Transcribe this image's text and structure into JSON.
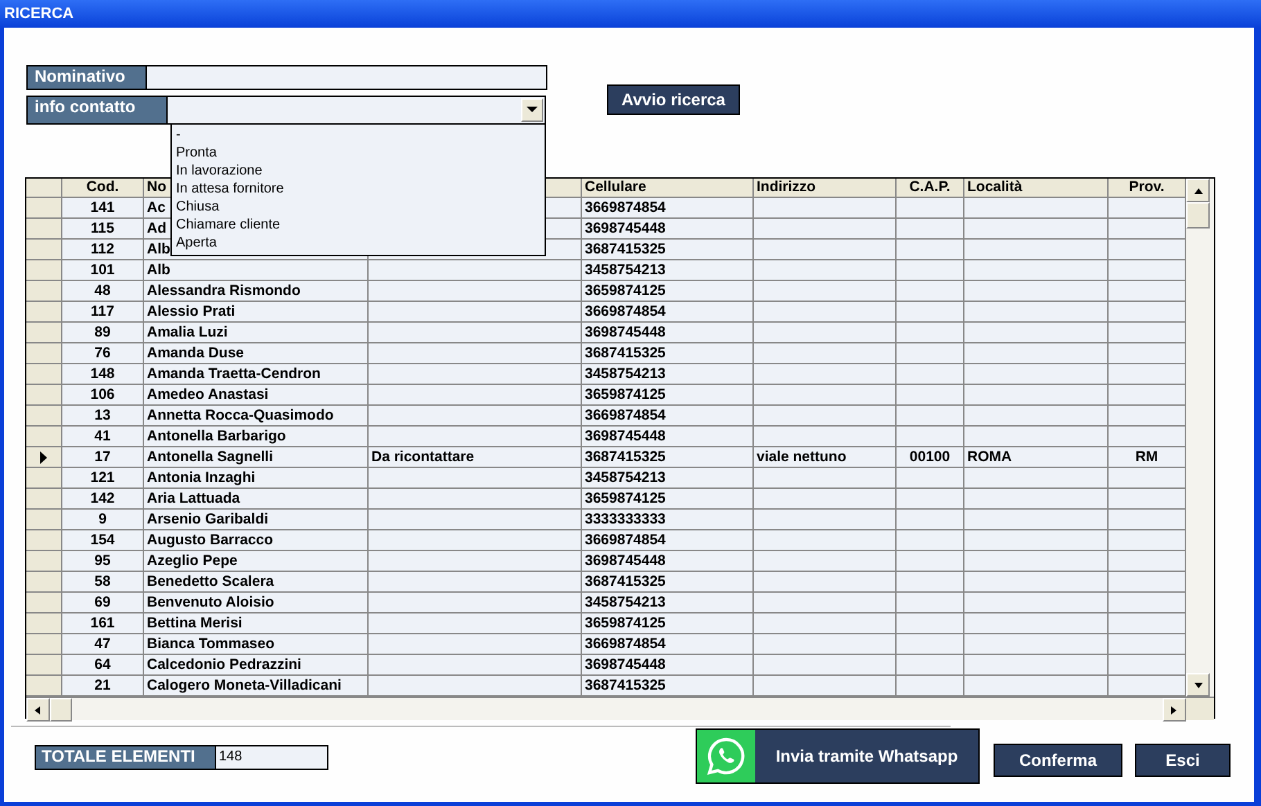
{
  "window": {
    "title": "RICERCA"
  },
  "search": {
    "nominativo": {
      "label": "Nominativo"
    },
    "info_contatto": {
      "label": "info contatto",
      "options": [
        {
          "label": "-"
        },
        {
          "label": "Pronta"
        },
        {
          "label": "In lavorazione"
        },
        {
          "label": "In attesa fornitore"
        },
        {
          "label": "Chiusa"
        },
        {
          "label": "Chiamare cliente"
        },
        {
          "label": "Aperta"
        }
      ],
      "expanded": true
    },
    "button": "Avvio ricerca"
  },
  "table": {
    "columns": [
      {
        "label": "Cod."
      },
      {
        "label": "No"
      },
      {},
      {
        "label": "Cellulare"
      },
      {
        "label": "Indirizzo"
      },
      {
        "label": "C.A.P."
      },
      {
        "label": "Località"
      },
      {
        "label": "Prov."
      }
    ],
    "rows": [
      {
        "cod": "141",
        "nome": "Ac",
        "cellulare": "3669874854",
        "current": false
      },
      {
        "cod": "115",
        "nome": "Ad",
        "cellulare": "3698745448",
        "current": false
      },
      {
        "cod": "112",
        "nome": "Alb",
        "cellulare": "3687415325",
        "current": false
      },
      {
        "cod": "101",
        "nome": "Alb",
        "cellulare": "3458754213",
        "current": false
      },
      {
        "cod": "48",
        "nome": "Alessandra Rismondo",
        "cellulare": "3659874125",
        "current": false
      },
      {
        "cod": "117",
        "nome": "Alessio Prati",
        "cellulare": "3669874854",
        "current": false
      },
      {
        "cod": "89",
        "nome": "Amalia Luzi",
        "cellulare": "3698745448",
        "current": false
      },
      {
        "cod": "76",
        "nome": "Amanda Duse",
        "cellulare": "3687415325",
        "current": false
      },
      {
        "cod": "148",
        "nome": "Amanda Traetta-Cendron",
        "cellulare": "3458754213",
        "current": false
      },
      {
        "cod": "106",
        "nome": "Amedeo Anastasi",
        "cellulare": "3659874125",
        "current": false
      },
      {
        "cod": "13",
        "nome": "Annetta Rocca-Quasimodo",
        "cellulare": "3669874854",
        "current": false
      },
      {
        "cod": "41",
        "nome": "Antonella Barbarigo",
        "cellulare": "3698745448",
        "current": false
      },
      {
        "cod": "17",
        "nome": "Antonella Sagnelli",
        "info": "Da ricontattare",
        "cellulare": "3687415325",
        "indirizzo": "viale nettuno",
        "cap": "00100",
        "localita": "ROMA",
        "prov": "RM",
        "current": true
      },
      {
        "cod": "121",
        "nome": "Antonia Inzaghi",
        "cellulare": "3458754213",
        "current": false
      },
      {
        "cod": "142",
        "nome": "Aria Lattuada",
        "cellulare": "3659874125",
        "current": false
      },
      {
        "cod": "9",
        "nome": "Arsenio Garibaldi",
        "cellulare": "3333333333",
        "current": false
      },
      {
        "cod": "154",
        "nome": "Augusto Barracco",
        "cellulare": "3669874854",
        "current": false
      },
      {
        "cod": "95",
        "nome": "Azeglio Pepe",
        "cellulare": "3698745448",
        "current": false
      },
      {
        "cod": "58",
        "nome": "Benedetto Scalera",
        "cellulare": "3687415325",
        "current": false
      },
      {
        "cod": "69",
        "nome": "Benvenuto Aloisio",
        "cellulare": "3458754213",
        "current": false
      },
      {
        "cod": "161",
        "nome": "Bettina Merisi",
        "cellulare": "3659874125",
        "current": false
      },
      {
        "cod": "47",
        "nome": "Bianca Tommaseo",
        "cellulare": "3669874854",
        "current": false
      },
      {
        "cod": "64",
        "nome": "Calcedonio Pedrazzini",
        "cellulare": "3698745448",
        "current": false
      },
      {
        "cod": "21",
        "nome": "Calogero Moneta-Villadicani",
        "cellulare": "3687415325",
        "current": false
      }
    ]
  },
  "footer": {
    "total_label": "TOTALE ELEMENTI",
    "total_value": "148",
    "buttons": [
      {
        "kind": "whatsapp",
        "label": "Invia tramite Whatsapp"
      },
      {
        "kind": "plain",
        "label": "Conferma"
      },
      {
        "kind": "plain",
        "label": "Esci"
      }
    ]
  }
}
